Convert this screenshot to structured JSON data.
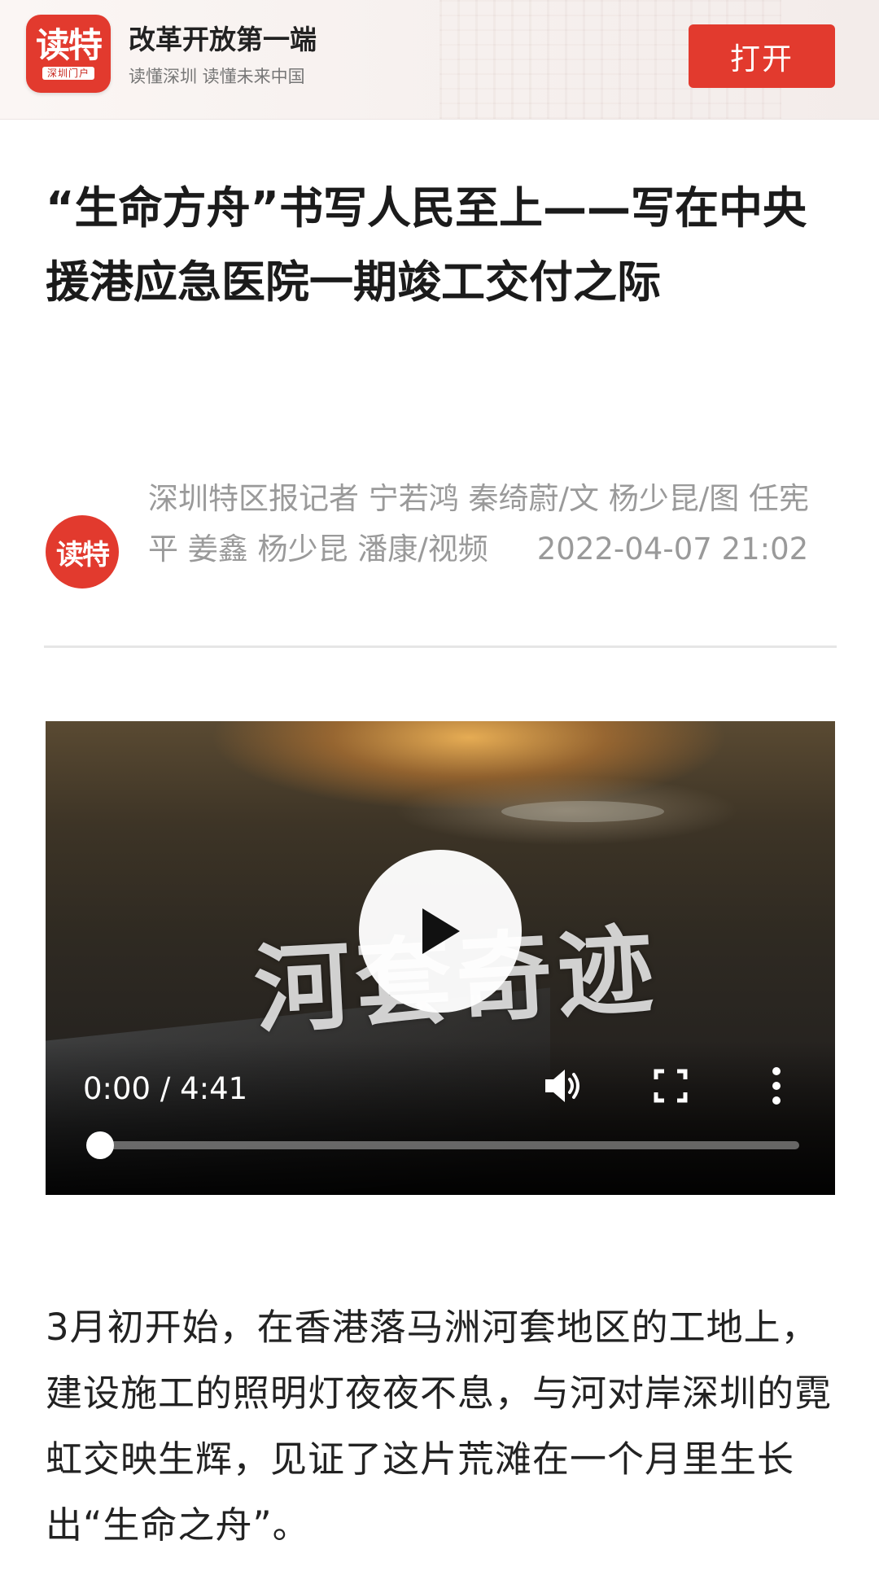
{
  "banner": {
    "logo_text": "读特",
    "logo_subtext": "深圳门户",
    "title": "改革开放第一端",
    "subtitle": "读懂深圳 读懂未来中国",
    "open_button_label": "打开"
  },
  "article": {
    "title": "“生命方舟”书写人民至上——写在中央援港应急医院一期竣工交付之际",
    "avatar_text": "读特",
    "byline": "深圳特区报记者 宁若鸿 秦绮蔚/文 杨少昆/图 任宪平 姜鑫 杨少昆 潘康/视频",
    "date": "2022-04-07 21:02",
    "body": "3月初开始，在香港落马洲河套地区的工地上，建设施工的照明灯夜夜不息，与河对岸深圳的霓虹交映生辉，见证了这片荒滩在一个月里生长出“生命之舟”。"
  },
  "video": {
    "caption": "河套奇迹",
    "time_display": "0:00 / 4:41",
    "progress_fraction": 0.0,
    "icons": {
      "play": "play-icon",
      "volume": "volume-icon",
      "fullscreen": "fullscreen-icon",
      "more": "more-vertical-icon"
    }
  },
  "colors": {
    "brand_red": "#e23a2e",
    "meta_gray": "#9a9a9a",
    "text_dark": "#222222"
  }
}
